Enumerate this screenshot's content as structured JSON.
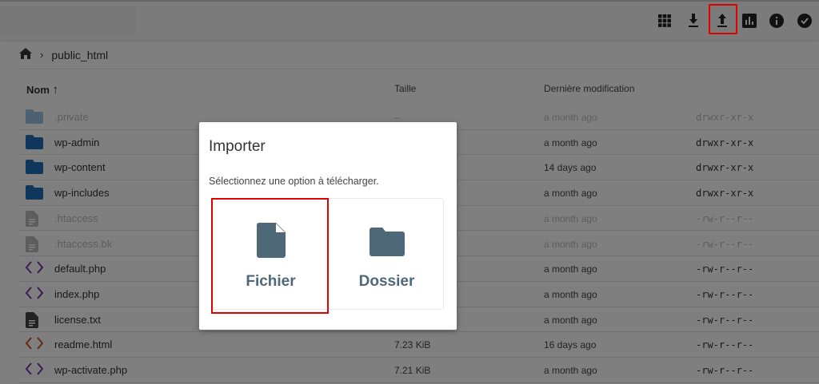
{
  "toolbar": {
    "icons": [
      "grid-icon",
      "download-icon",
      "upload-icon",
      "stats-icon",
      "info-icon",
      "check-icon"
    ]
  },
  "breadcrumb": {
    "path": "public_html"
  },
  "table": {
    "headers": {
      "name": "Nom",
      "size": "Taille",
      "modified": "Dernière modification"
    },
    "rows": [
      {
        "name": ".private",
        "size": "–",
        "modified": "a month ago",
        "perms": "drwxr-xr-x",
        "type": "folder",
        "faded": true
      },
      {
        "name": "wp-admin",
        "size": "",
        "modified": "a month ago",
        "perms": "drwxr-xr-x",
        "type": "folder"
      },
      {
        "name": "wp-content",
        "size": "",
        "modified": "14 days ago",
        "perms": "drwxr-xr-x",
        "type": "folder"
      },
      {
        "name": "wp-includes",
        "size": "",
        "modified": "a month ago",
        "perms": "drwxr-xr-x",
        "type": "folder"
      },
      {
        "name": ".htaccess",
        "size": "",
        "modified": "a month ago",
        "perms": "-rw-r--r--",
        "type": "doc",
        "faded": true
      },
      {
        "name": ".htaccess.bk",
        "size": "",
        "modified": "a month ago",
        "perms": "-rw-r--r--",
        "type": "doc",
        "faded": true
      },
      {
        "name": "default.php",
        "size": "",
        "modified": "a month ago",
        "perms": "-rw-r--r--",
        "type": "code"
      },
      {
        "name": "index.php",
        "size": "",
        "modified": "a month ago",
        "perms": "-rw-r--r--",
        "type": "code"
      },
      {
        "name": "license.txt",
        "size": "",
        "modified": "a month ago",
        "perms": "-rw-r--r--",
        "type": "doc"
      },
      {
        "name": "readme.html",
        "size": "7.23 KiB",
        "modified": "16 days ago",
        "perms": "-rw-r--r--",
        "type": "html"
      },
      {
        "name": "wp-activate.php",
        "size": "7.21 KiB",
        "modified": "a month ago",
        "perms": "-rw-r--r--",
        "type": "code"
      }
    ]
  },
  "modal": {
    "title": "Importer",
    "subtitle": "Sélectionnez une option à télécharger.",
    "options": {
      "file": "Fichier",
      "folder": "Dossier"
    }
  },
  "colors": {
    "folder": "#1f6fb8",
    "code": "#6a3fa0",
    "html": "#d0532a",
    "doc": "#444444",
    "highlight": "#e00000",
    "option": "#4f6878"
  }
}
